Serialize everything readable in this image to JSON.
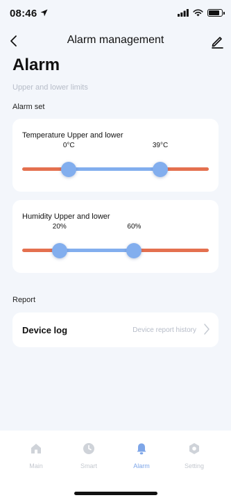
{
  "status_bar": {
    "time": "08:46",
    "battery_level": 0.85
  },
  "nav": {
    "title": "Alarm management"
  },
  "page": {
    "title": "Alarm",
    "subtitle": "Upper and lower limits",
    "alarm_set_label": "Alarm set",
    "report_label": "Report"
  },
  "temperature": {
    "title": "Temperature Upper and lower",
    "lower_label": "0°C",
    "upper_label": "39°C",
    "lower_fraction": 0.25,
    "upper_fraction": 0.74
  },
  "humidity": {
    "title": "Humidity Upper and lower",
    "lower_label": "20%",
    "upper_label": "60%",
    "lower_fraction": 0.2,
    "upper_fraction": 0.6
  },
  "device_log": {
    "title": "Device log",
    "hint": "Device report history"
  },
  "tabs": [
    {
      "label": "Main",
      "icon": "home-icon",
      "active": false
    },
    {
      "label": "Smart",
      "icon": "clock-icon",
      "active": false
    },
    {
      "label": "Alarm",
      "icon": "bell-icon",
      "active": true
    },
    {
      "label": "Setting",
      "icon": "gear-icon",
      "active": false
    }
  ],
  "colors": {
    "track_out": "#e4704f",
    "track_in": "#82aeee",
    "thumb": "#82aeee",
    "active_tab": "#7ea6e8",
    "inactive_tab": "#c4c8cf",
    "background": "#f3f6fb"
  }
}
